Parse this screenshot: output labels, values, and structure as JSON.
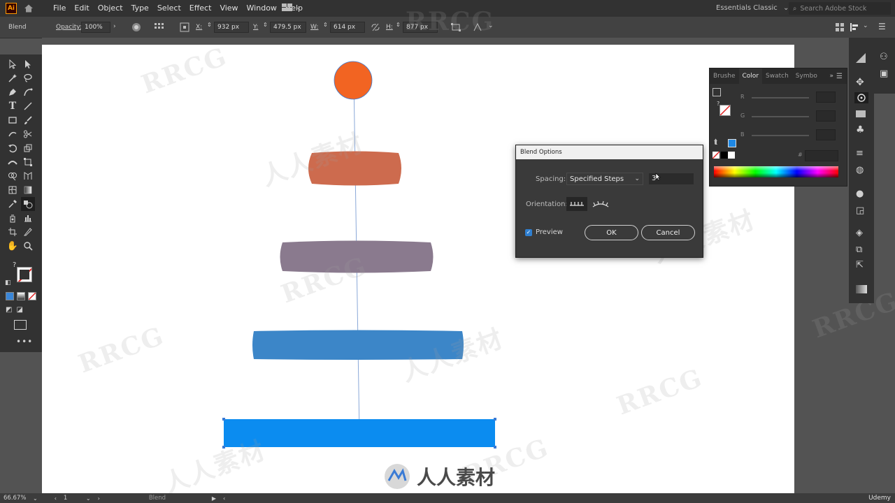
{
  "app": {
    "logo_text": "Ai",
    "menu": [
      "File",
      "Edit",
      "Object",
      "Type",
      "Select",
      "Effect",
      "View",
      "Window",
      "Help"
    ],
    "workspace": "Essentials Classic",
    "search_placeholder": "Search Adobe Stock"
  },
  "control_bar": {
    "selection_label": "Blend",
    "opacity_label": "Opacity:",
    "opacity_value": "100%",
    "x_label": "X:",
    "x_value": "932 px",
    "y_label": "Y:",
    "y_value": "479.5 px",
    "w_label": "W:",
    "w_value": "614 px",
    "h_label": "H:",
    "h_value": "877 px"
  },
  "color_panel": {
    "tabs": [
      "Brushe",
      "Color",
      "Swatch",
      "Symbo"
    ],
    "active_tab": "Color",
    "r_label": "R",
    "g_label": "G",
    "b_label": "B",
    "hex_label": "#"
  },
  "blend_dialog": {
    "title": "Blend Options",
    "spacing_label": "Spacing:",
    "spacing_value": "Specified Steps",
    "steps_value": "3",
    "orientation_label": "Orientation:",
    "preview_label": "Preview",
    "preview_checked": true,
    "ok_label": "OK",
    "cancel_label": "Cancel"
  },
  "status_bar": {
    "zoom": "66.67%",
    "artboard_number": "1",
    "tool_name": "Blend"
  },
  "colors": {
    "circle": "#f26422",
    "shape2": "#cd6b4e",
    "shape3": "#8a7a8e",
    "shape4": "#3c86c8",
    "rect": "#0b8cf0",
    "spine": "#8aa8d8"
  },
  "watermark": {
    "text": "RRCG",
    "cn_text": "人人素材",
    "udemy": "Udemy"
  }
}
